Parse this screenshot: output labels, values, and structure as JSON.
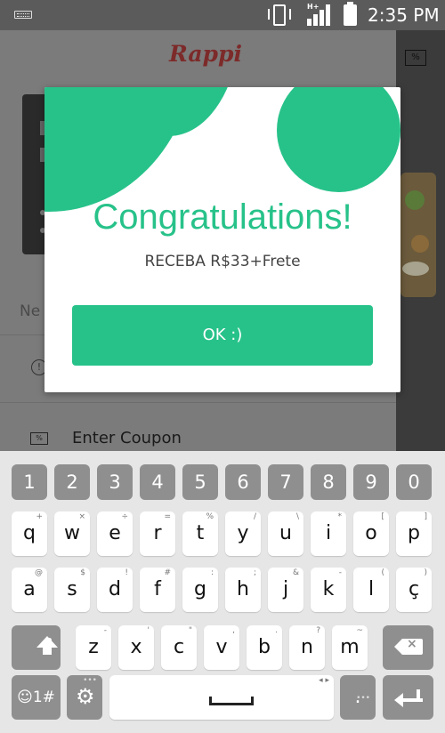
{
  "status_bar": {
    "time": "2:35 PM",
    "network_label": "H+"
  },
  "app": {
    "logo": "Rappi",
    "partial_text": "Ne",
    "coupon_item_label": "Enter Coupon",
    "coupon_icon_text": "%",
    "info_icon_text": "!"
  },
  "dialog": {
    "title": "Congratulations!",
    "subtitle": "RECEBA R$33+Frete",
    "ok_label": "OK :)",
    "accent_color": "#27c28a"
  },
  "keyboard": {
    "number_row": [
      "1",
      "2",
      "3",
      "4",
      "5",
      "6",
      "7",
      "8",
      "9",
      "0"
    ],
    "row1": [
      {
        "key": "q",
        "hint": "+"
      },
      {
        "key": "w",
        "hint": "×"
      },
      {
        "key": "e",
        "hint": "÷"
      },
      {
        "key": "r",
        "hint": "="
      },
      {
        "key": "t",
        "hint": "%"
      },
      {
        "key": "y",
        "hint": "/"
      },
      {
        "key": "u",
        "hint": "\\"
      },
      {
        "key": "i",
        "hint": "*"
      },
      {
        "key": "o",
        "hint": "["
      },
      {
        "key": "p",
        "hint": "]"
      }
    ],
    "row2": [
      {
        "key": "a",
        "hint": "@"
      },
      {
        "key": "s",
        "hint": "$"
      },
      {
        "key": "d",
        "hint": "!"
      },
      {
        "key": "f",
        "hint": "#"
      },
      {
        "key": "g",
        "hint": ":"
      },
      {
        "key": "h",
        "hint": ";"
      },
      {
        "key": "j",
        "hint": "&"
      },
      {
        "key": "k",
        "hint": "-"
      },
      {
        "key": "l",
        "hint": "("
      },
      {
        "key": "ç",
        "hint": ")"
      }
    ],
    "row3": [
      {
        "key": "z",
        "hint": "-"
      },
      {
        "key": "x",
        "hint": "'"
      },
      {
        "key": "c",
        "hint": "\""
      },
      {
        "key": "v",
        "hint": ","
      },
      {
        "key": "b",
        "hint": "."
      },
      {
        "key": "n",
        "hint": "?"
      },
      {
        "key": "m",
        "hint": "~"
      }
    ],
    "emoji_key_label": "☺1#",
    "period_key_label": ".",
    "space_hint": "◂ ▸",
    "period_hint": "•••",
    "settings_hint": "•••"
  }
}
